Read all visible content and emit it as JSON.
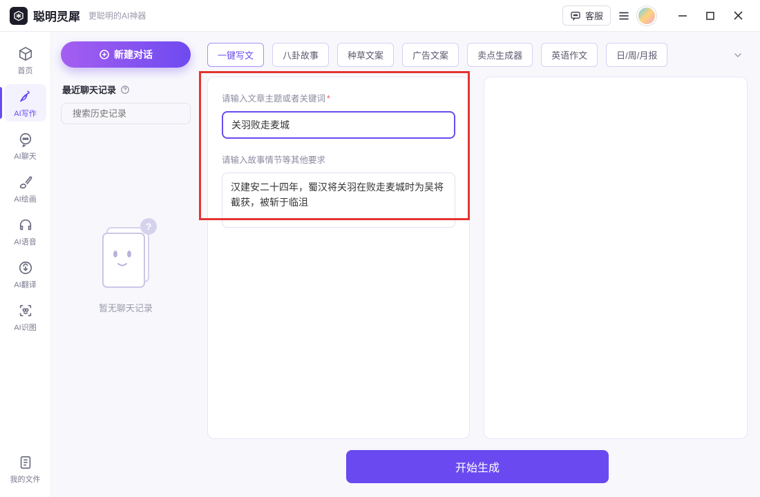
{
  "titlebar": {
    "app_name": "聪明灵犀",
    "app_subtitle": "更聪明的AI神器",
    "help_label": "客服"
  },
  "side": {
    "home": "首页",
    "writing": "AI写作",
    "chat": "AI聊天",
    "paint": "AI绘画",
    "voice": "AI语音",
    "translate": "AI翻译",
    "ocr": "AI识图",
    "files": "我的文件"
  },
  "history": {
    "new_chat": "新建对话",
    "header": "最近聊天记录",
    "search_placeholder": "搜索历史记录",
    "empty": "暂无聊天记录"
  },
  "tags": {
    "t0": "一键写文",
    "t1": "八卦故事",
    "t2": "种草文案",
    "t3": "广告文案",
    "t4": "卖点生成器",
    "t5": "英语作文",
    "t6": "日/周/月报"
  },
  "form": {
    "topic_label": "请输入文章主题或者关键词",
    "topic_value": "关羽败走麦城",
    "details_label": "请输入故事情节等其他要求",
    "details_value": "汉建安二十四年，蜀汉将关羽在败走麦城时为吴将截获，被斩于临沮",
    "generate": "开始生成"
  }
}
